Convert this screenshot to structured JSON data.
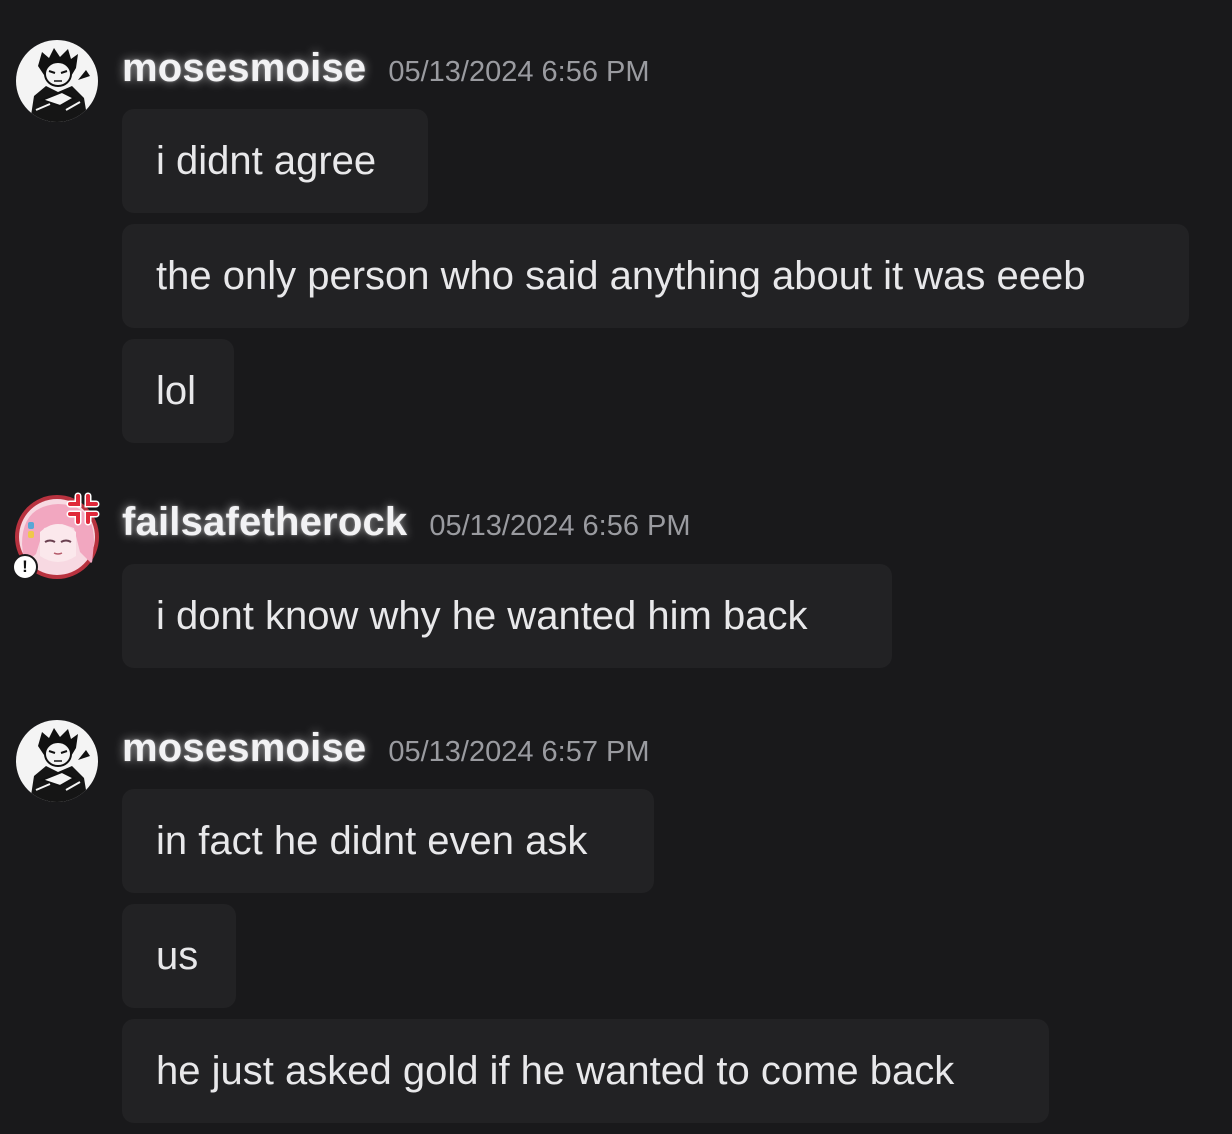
{
  "messages": [
    {
      "username": "mosesmoise",
      "timestamp": "05/13/2024 6:56 PM",
      "lines": [
        "i didnt agree",
        "the only person who said anything about it was eeeb",
        "lol"
      ]
    },
    {
      "username": "failsafetherock",
      "timestamp": "05/13/2024 6:56 PM",
      "lines": [
        "i dont know why he wanted him back"
      ],
      "badge_icon": "exclamation-icon",
      "badge_text": "!"
    },
    {
      "username": "mosesmoise",
      "timestamp": "05/13/2024 6:57 PM",
      "lines": [
        "in fact he didnt even ask",
        "us",
        "he just asked gold if he wanted to come back"
      ]
    }
  ],
  "colors": {
    "background": "#19191b",
    "bubble": "#222224",
    "username": "#f2f2f4",
    "timestamp": "#9a9ba0",
    "anger_mark": "#e0283a",
    "avatar_pink_hair": "#f2a7c0"
  },
  "icons": {
    "avatar_mosesmoise": "manga-character-avatar",
    "avatar_failsafetherock": "pink-hair-anime-avatar",
    "anger_mark": "anger-vein-icon"
  }
}
